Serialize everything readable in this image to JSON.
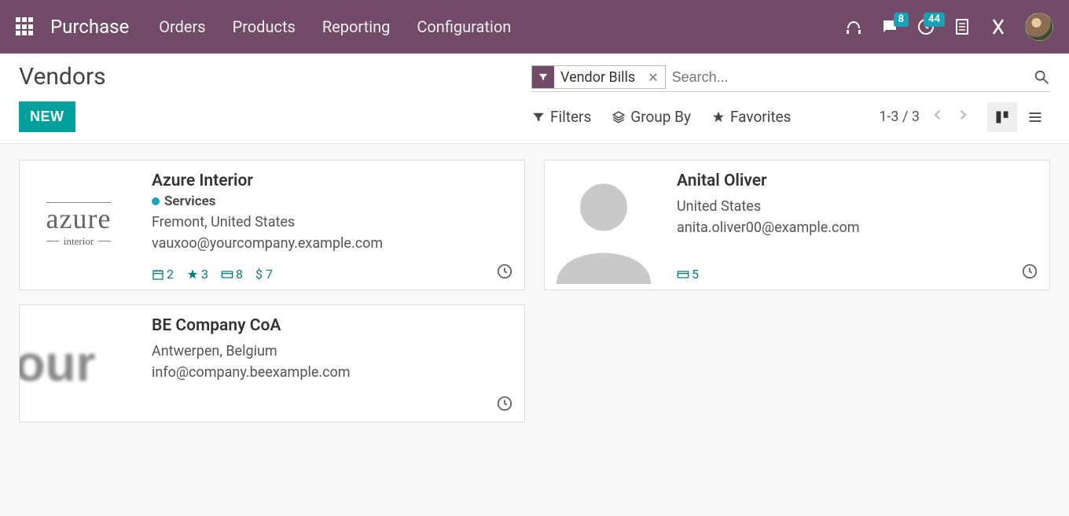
{
  "nav": {
    "app_title": "Purchase",
    "links": [
      "Orders",
      "Products",
      "Reporting",
      "Configuration"
    ],
    "discuss_badge": "8",
    "activity_badge": "44"
  },
  "control": {
    "title": "Vendors",
    "new_button": "NEW",
    "filter_chip": "Vendor Bills",
    "search_placeholder": "Search...",
    "filters_label": "Filters",
    "groupby_label": "Group By",
    "favorites_label": "Favorites",
    "pager": "1-3 / 3"
  },
  "vendors": [
    {
      "name": "Azure Interior",
      "tag": "Services",
      "location": "Fremont, United States",
      "email": "vauxoo@yourcompany.example.com",
      "stats": {
        "meetings": "2",
        "opps": "3",
        "bills": "8",
        "amount": "$ 7"
      },
      "logo": "azure"
    },
    {
      "name": "BE Company CoA",
      "location": "Antwerpen, Belgium",
      "email": "info@company.beexample.com",
      "logo": "be"
    },
    {
      "name": "Anital Oliver",
      "location": "United States",
      "email": "anita.oliver00@example.com",
      "stats": {
        "bills": "5"
      },
      "logo": "person"
    }
  ]
}
